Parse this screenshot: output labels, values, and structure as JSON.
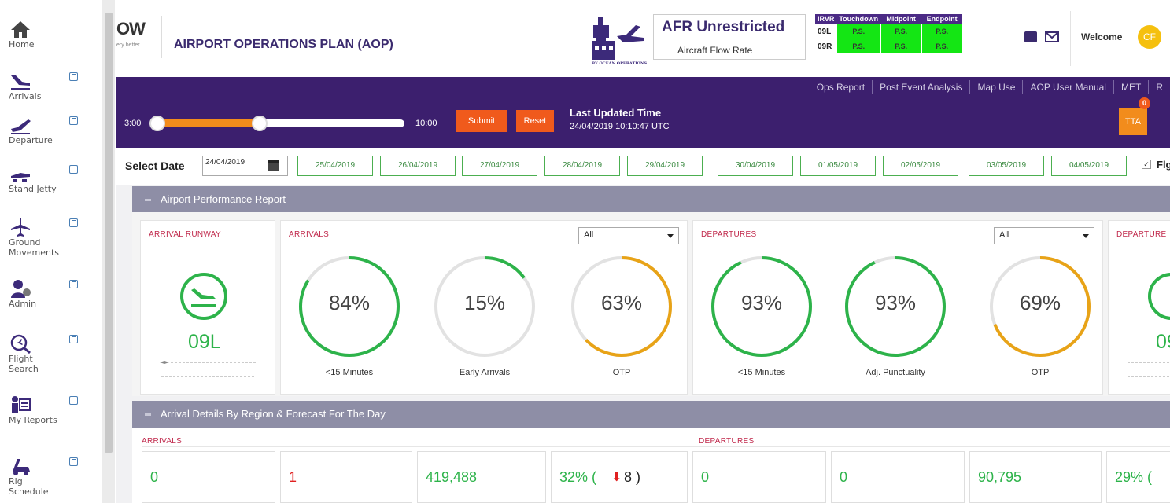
{
  "sidebar": {
    "items": [
      {
        "label": "Home",
        "icon": "home-icon"
      },
      {
        "label": "Arrivals",
        "icon": "arrival-plane-icon"
      },
      {
        "label": "Departure",
        "icon": "departure-plane-icon"
      },
      {
        "label": "Stand Jetty",
        "icon": "stand-jetty-icon"
      },
      {
        "label": "Ground Movements",
        "icon": "ground-plane-icon"
      },
      {
        "label": "Admin",
        "icon": "admin-user-icon"
      },
      {
        "label": "Flight Search",
        "icon": "flight-search-icon"
      },
      {
        "label": "My Reports",
        "icon": "report-person-icon"
      },
      {
        "label": "Rig Schedule",
        "icon": "rig-vehicle-icon"
      }
    ]
  },
  "header": {
    "logo_fragment": "OW",
    "logo_tagline": "ery better",
    "title": "AIRPORT OPERATIONS PLAN (AOP)",
    "ops_logo_text": "BY OCEAN OPERATIONS",
    "afr_title": "AFR Unrestricted",
    "afr_subtitle": "Aircraft Flow Rate",
    "rvr": {
      "headers": [
        "IRVR",
        "Touchdown",
        "Midpoint",
        "Endpoint"
      ],
      "rows": [
        {
          "runway": "09L",
          "values": [
            "P.S.",
            "P.S.",
            "P.S."
          ]
        },
        {
          "runway": "09R",
          "values": [
            "P.S.",
            "P.S.",
            "P.S."
          ]
        }
      ]
    },
    "welcome": "Welcome",
    "avatar_initials": "CF"
  },
  "toolbar": {
    "links": [
      "Ops Report",
      "Post Event Analysis",
      "Map Use",
      "AOP User Manual",
      "MET",
      "R"
    ],
    "slider_start": "3:00",
    "slider_end": "10:00",
    "slider_fill_fraction": 0.42,
    "submit_label": "Submit",
    "reset_label": "Reset",
    "last_updated_label": "Last Updated Time",
    "last_updated_value": "24/04/2019 10:10:47 UTC",
    "tta_label": "TTA",
    "tta_badge": "0"
  },
  "dates": {
    "label": "Select Date",
    "current": "24/04/2019",
    "options": [
      "25/04/2019",
      "26/04/2019",
      "27/04/2019",
      "28/04/2019",
      "29/04/2019",
      "30/04/2019",
      "01/05/2019",
      "02/05/2019",
      "03/05/2019",
      "04/05/2019"
    ],
    "flight_label": "Flg"
  },
  "performance": {
    "section_title": "Airport Performance Report",
    "arrival_runway": {
      "title": "ARRIVAL RUNWAY",
      "runway": "09L"
    },
    "arrivals": {
      "title": "ARRIVALS",
      "filter": "All",
      "gauges": [
        {
          "pct": "84%",
          "label": "<15 Minutes",
          "fraction": 0.84,
          "color": "#2db34a"
        },
        {
          "pct": "15%",
          "label": "Early Arrivals",
          "fraction": 0.15,
          "color": "#2db34a"
        },
        {
          "pct": "63%",
          "label": "OTP",
          "fraction": 0.63,
          "color": "#e8a317"
        }
      ]
    },
    "departures": {
      "title": "DEPARTURES",
      "filter": "All",
      "gauges": [
        {
          "pct": "93%",
          "label": "<15 Minutes",
          "fraction": 0.93,
          "color": "#2db34a"
        },
        {
          "pct": "93%",
          "label": "Adj. Punctuality",
          "fraction": 0.93,
          "color": "#2db34a"
        },
        {
          "pct": "69%",
          "label": "OTP",
          "fraction": 0.69,
          "color": "#e8a317"
        }
      ]
    },
    "departure_runway": {
      "title": "DEPARTURE",
      "runway": "09"
    }
  },
  "details": {
    "section_title": "Arrival Details By Region & Forecast For The Day",
    "arrivals_head": "ARRIVALS",
    "departures_head": "DEPARTURES",
    "cells": [
      {
        "value": "0",
        "color": "#2db34a"
      },
      {
        "value": "1",
        "color": "#e02020"
      },
      {
        "value": "419,488",
        "color": "#2db34a"
      },
      {
        "value": "32% (",
        "extra": "8 )",
        "color": "#2db34a"
      },
      {
        "value": "0",
        "color": "#2db34a"
      },
      {
        "value": "0",
        "color": "#2db34a"
      },
      {
        "value": "90,795",
        "color": "#2db34a"
      },
      {
        "value": "29% (",
        "color": "#2db34a"
      }
    ]
  },
  "colors": {
    "purple": "#3c1f6e",
    "orange": "#f05a1c",
    "green": "#2db34a",
    "amber": "#e8a317"
  }
}
